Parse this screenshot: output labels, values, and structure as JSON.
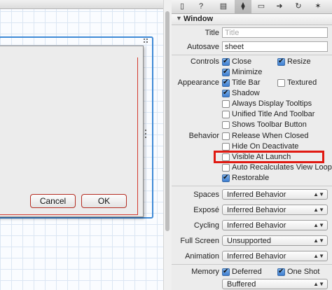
{
  "canvas": {
    "cancel_label": "Cancel",
    "ok_label": "OK"
  },
  "toolbar": {
    "icons": [
      "file-icon",
      "help-icon",
      "identity-icon",
      "attributes-icon",
      "ruler-icon",
      "connections-icon",
      "bindings-icon",
      "effects-icon"
    ]
  },
  "inspector": {
    "section_title": "Window",
    "title_label": "Title",
    "title_placeholder": "Title",
    "autosave_label": "Autosave",
    "autosave_value": "sheet",
    "controls_label": "Controls",
    "close": {
      "label": "Close",
      "checked": true
    },
    "resize": {
      "label": "Resize",
      "checked": true
    },
    "minimize": {
      "label": "Minimize",
      "checked": true
    },
    "appearance_label": "Appearance",
    "title_bar": {
      "label": "Title Bar",
      "checked": true
    },
    "textured": {
      "label": "Textured",
      "checked": false
    },
    "shadow": {
      "label": "Shadow",
      "checked": true
    },
    "always_tooltips": {
      "label": "Always Display Tooltips",
      "checked": false
    },
    "unified": {
      "label": "Unified Title And Toolbar",
      "checked": false
    },
    "shows_toolbar": {
      "label": "Shows Toolbar Button",
      "checked": false
    },
    "behavior_label": "Behavior",
    "release": {
      "label": "Release When Closed",
      "checked": false
    },
    "hide_deactivate": {
      "label": "Hide On Deactivate",
      "checked": false
    },
    "visible_launch": {
      "label": "Visible At Launch",
      "checked": false
    },
    "auto_recalc": {
      "label": "Auto Recalculates View Loop",
      "checked": false
    },
    "restorable": {
      "label": "Restorable",
      "checked": true
    },
    "spaces_label": "Spaces",
    "spaces_value": "Inferred Behavior",
    "expose_label": "Exposé",
    "expose_value": "Inferred Behavior",
    "cycling_label": "Cycling",
    "cycling_value": "Inferred Behavior",
    "fullscreen_label": "Full Screen",
    "fullscreen_value": "Unsupported",
    "animation_label": "Animation",
    "animation_value": "Inferred Behavior",
    "memory_label": "Memory",
    "deferred": {
      "label": "Deferred",
      "checked": true
    },
    "one_shot": {
      "label": "One Shot",
      "checked": true
    },
    "memory_value": "Buffered"
  },
  "colors": {
    "highlight": "#e01a12",
    "selection_outline": "#3f8ad6",
    "checkbox_on": "#3d7ed0"
  }
}
